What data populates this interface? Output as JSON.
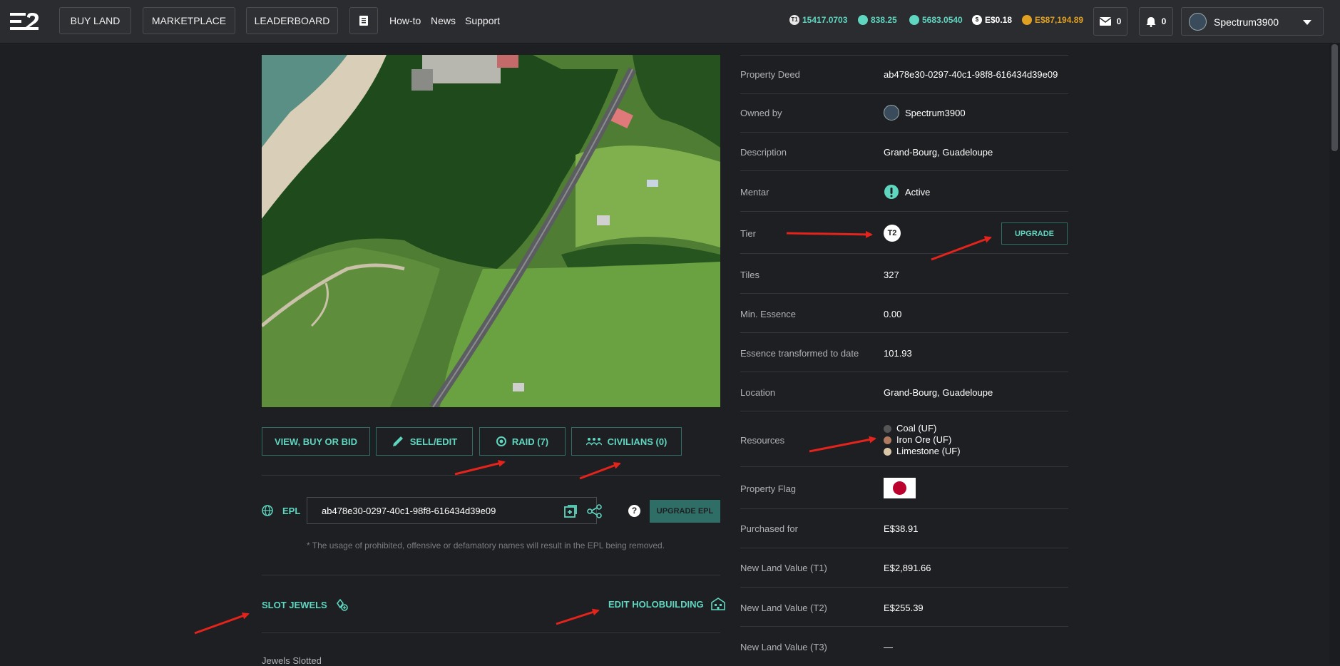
{
  "nav": {
    "buy_land": "BUY LAND",
    "marketplace": "MARKETPLACE",
    "leaderboard": "LEADERBOARD",
    "howto": "How-to",
    "news": "News",
    "support": "Support"
  },
  "balances": {
    "t1": "15417.0703",
    "b2": "838.25",
    "b3": "5683.0540",
    "usd": "E$0.18",
    "gold": "E$87,194.89"
  },
  "counts": {
    "mail": "0",
    "notifications": "0"
  },
  "user": {
    "name": "Spectrum3900"
  },
  "actions": {
    "view_buy_bid": "VIEW, BUY OR BID",
    "sell_edit": "SELL/EDIT",
    "raid": "RAID (7)",
    "civilians": "CIVILIANS (0)"
  },
  "epl": {
    "label": "EPL",
    "value": "ab478e30-0297-40c1-98f8-616434d39e09",
    "help": "?",
    "upgrade": "UPGRADE EPL",
    "note": "* The usage of prohibited, offensive or defamatory names will result in the EPL being removed."
  },
  "links": {
    "slot_jewels": "SLOT JEWELS",
    "edit_holobuilding": "EDIT HOLOBUILDING",
    "jewels_slotted": "Jewels Slotted"
  },
  "details": {
    "property_deed": {
      "label": "Property Deed",
      "value": "ab478e30-0297-40c1-98f8-616434d39e09"
    },
    "owned_by": {
      "label": "Owned by",
      "value": "Spectrum3900"
    },
    "description": {
      "label": "Description",
      "value": "Grand-Bourg, Guadeloupe"
    },
    "mentar": {
      "label": "Mentar",
      "value": "Active"
    },
    "tier": {
      "label": "Tier",
      "value": "T2",
      "upgrade": "UPGRADE"
    },
    "tiles": {
      "label": "Tiles",
      "value": "327"
    },
    "min_essence": {
      "label": "Min. Essence",
      "value": "0.00"
    },
    "essence": {
      "label": "Essence transformed to date",
      "value": "101.93"
    },
    "location": {
      "label": "Location",
      "value": "Grand-Bourg, Guadeloupe"
    },
    "resources": {
      "label": "Resources",
      "items": [
        "Coal (UF)",
        "Iron Ore (UF)",
        "Limestone (UF)"
      ]
    },
    "flag": {
      "label": "Property Flag"
    },
    "purchased": {
      "label": "Purchased for",
      "value": "E$38.91"
    },
    "t1_value": {
      "label": "New Land Value (T1)",
      "value": "E$2,891.66"
    },
    "t2_value": {
      "label": "New Land Value (T2)",
      "value": "E$255.39"
    },
    "t3_value": {
      "label": "New Land Value (T3)",
      "value": "—"
    }
  },
  "colors": {
    "accent": "#5fd6c0",
    "background": "#1e1f22",
    "topbar": "#2b2c30",
    "annotation": "#e3231c"
  }
}
